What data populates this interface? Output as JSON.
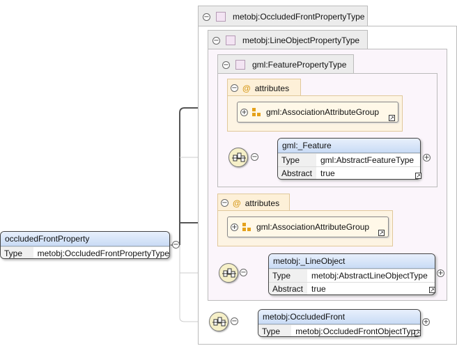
{
  "root_element": {
    "name": "occludedFrontProperty",
    "type_label": "Type",
    "type_value": "metobj:OccludedFrontPropertyType"
  },
  "outer_type": {
    "name": "metobj:OccludedFrontPropertyType"
  },
  "line_type": {
    "name": "metobj:LineObjectPropertyType"
  },
  "feature_type": {
    "name": "gml:FeaturePropertyType"
  },
  "attributes_1": {
    "label": "attributes",
    "group": "gml:AssociationAttributeGroup"
  },
  "attributes_2": {
    "label": "attributes",
    "group": "gml:AssociationAttributeGroup"
  },
  "feature_elem": {
    "name": "gml:_Feature",
    "type_label": "Type",
    "type_value": "gml:AbstractFeatureType",
    "abstract_label": "Abstract",
    "abstract_value": "true"
  },
  "line_elem": {
    "name": "metobj:_LineObject",
    "type_label": "Type",
    "type_value": "metobj:AbstractLineObjectType",
    "abstract_label": "Abstract",
    "abstract_value": "true"
  },
  "occluded_elem": {
    "name": "metobj:OccludedFront",
    "type_label": "Type",
    "type_value": "metobj:OccludedFrontObjectType"
  },
  "colors": {
    "type_box_bg": "#fbf5fb",
    "attr_bg": "#fdf4e3",
    "elem_header": "#c9dbf5",
    "sequence_bg": "#f6f0c8"
  }
}
